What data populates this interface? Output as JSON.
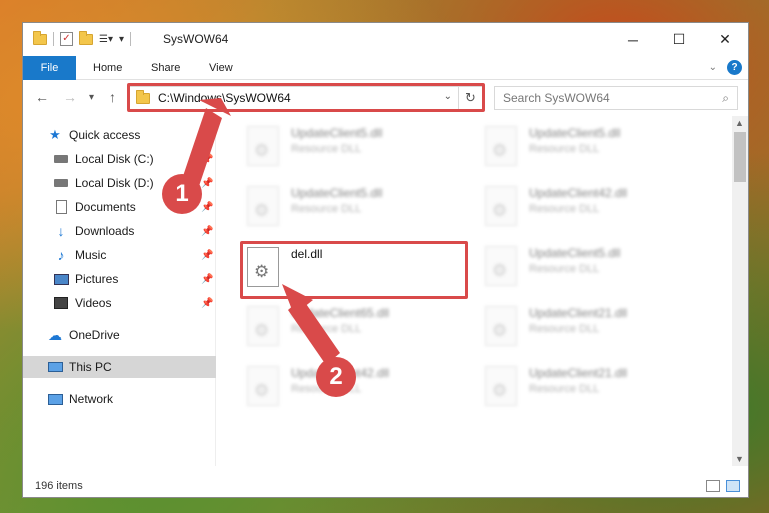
{
  "window": {
    "title": "SysWOW64",
    "controls": {
      "minimize": "─",
      "maximize": "☐",
      "close": "✕"
    }
  },
  "ribbon": {
    "file": "File",
    "tabs": [
      "Home",
      "Share",
      "View"
    ],
    "help": "?"
  },
  "nav": {
    "back": "←",
    "forward": "→",
    "recent": "▾",
    "up": "↑"
  },
  "address": {
    "path": "C:\\Windows\\SysWOW64",
    "refresh": "↻"
  },
  "search": {
    "placeholder": "Search SysWOW64",
    "icon": "search-icon"
  },
  "sidebar": {
    "items": [
      {
        "label": "Quick access",
        "icon": "star-icon"
      },
      {
        "label": "Local Disk (C:)",
        "icon": "drive-icon",
        "pinned": true
      },
      {
        "label": "Local Disk (D:)",
        "icon": "drive-icon",
        "pinned": true
      },
      {
        "label": "Documents",
        "icon": "documents-icon",
        "pinned": true
      },
      {
        "label": "Downloads",
        "icon": "downloads-icon",
        "pinned": true
      },
      {
        "label": "Music",
        "icon": "music-icon",
        "pinned": true
      },
      {
        "label": "Pictures",
        "icon": "pictures-icon",
        "pinned": true
      },
      {
        "label": "Videos",
        "icon": "videos-icon",
        "pinned": true
      },
      {
        "label": "OneDrive",
        "icon": "onedrive-icon"
      },
      {
        "label": "This PC",
        "icon": "this-pc-icon",
        "selected": true
      },
      {
        "label": "Network",
        "icon": "network-icon"
      }
    ]
  },
  "files": [
    {
      "name": "UpdateClient5.dll",
      "type": "Resource DLL"
    },
    {
      "name": "UpdateClient5.dll",
      "type": "Resource DLL"
    },
    {
      "name": "UpdateClient5.dll",
      "type": "Resource DLL"
    },
    {
      "name": "UpdateClient42.dll",
      "type": "Resource DLL"
    },
    {
      "name": "del.dll",
      "type": ""
    },
    {
      "name": "UpdateClient5.dll",
      "type": "Resource DLL"
    },
    {
      "name": "UpdateClient65.dll",
      "type": "Resource DLL"
    },
    {
      "name": "UpdateClient21.dll",
      "type": "Resource DLL"
    },
    {
      "name": "UpdateClient42.dll",
      "type": "Resource DLL"
    },
    {
      "name": "UpdateClient21.dll",
      "type": "Resource DLL"
    }
  ],
  "status": {
    "count": "196 items"
  },
  "callouts": {
    "step1": "1",
    "step2": "2"
  },
  "colors": {
    "accent": "#1979ca",
    "highlight": "#d94a4a"
  }
}
